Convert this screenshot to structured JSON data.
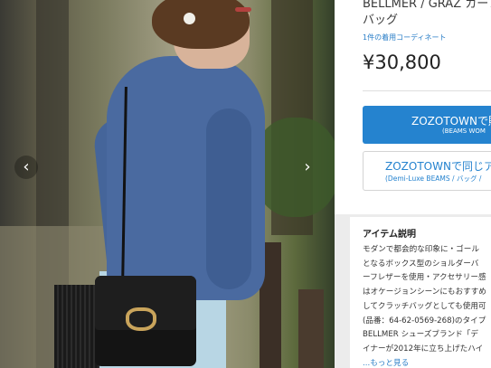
{
  "product": {
    "brand_title_line1": "BELLMER / GRAZ カーフレ",
    "brand_title_line2": "バッグ",
    "coordinate_link": "1件の着用コーディネート",
    "price": "¥30,800"
  },
  "buttons": {
    "zozotown_main": "ZOZOTOWNで購",
    "zozotown_main_sub": "(BEAMS WOM",
    "zozotown_alt": "ZOZOTOWNで同じア",
    "zozotown_alt_sub": "(Demi-Luxe BEAMS / バッグ /"
  },
  "carousel": {
    "prev_glyph": "‹",
    "next_glyph": "›"
  },
  "description": {
    "title": "アイテム説明",
    "lines": [
      "モダンで都会的な印象に・ゴール",
      "となるボックス型のショルダーバ",
      "ーフレザーを使用・アクセサリー感",
      "はオケージョンシーンにもおすすめ",
      "してクラッチバッグとしても使用可",
      "(品番：64-62-0569-268)のタイプ",
      "BELLMER シューズブランド「デ",
      "イナーが2012年に立ち上げたハイ"
    ],
    "more_link": "...もっと見る"
  }
}
